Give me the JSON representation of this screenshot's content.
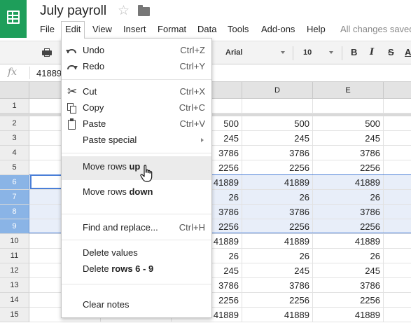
{
  "app": {
    "title": "July payroll",
    "star_icon": "star-icon",
    "folder_icon": "folder-icon",
    "save_status": "All changes saved"
  },
  "menubar": {
    "items": [
      "File",
      "Edit",
      "View",
      "Insert",
      "Format",
      "Data",
      "Tools",
      "Add-ons",
      "Help"
    ]
  },
  "toolbar": {
    "font": "Arial",
    "font_size": "10",
    "bold": "B",
    "italic": "I",
    "strike": "S",
    "text_color": "A"
  },
  "formula_bar": {
    "fx_label": "fx",
    "value": "41889"
  },
  "columns": [
    "D",
    "E"
  ],
  "rows": [
    {
      "num": "1",
      "c": "",
      "d": "",
      "e": ""
    },
    {
      "num": "2",
      "c": "500",
      "d": "500",
      "e": "500"
    },
    {
      "num": "3",
      "c": "245",
      "d": "245",
      "e": "245"
    },
    {
      "num": "4",
      "c": "3786",
      "d": "3786",
      "e": "3786"
    },
    {
      "num": "5",
      "c": "2256",
      "d": "2256",
      "e": "2256"
    },
    {
      "num": "6",
      "c": "41889",
      "d": "41889",
      "e": "41889"
    },
    {
      "num": "7",
      "c": "26",
      "d": "26",
      "e": "26"
    },
    {
      "num": "8",
      "c": "3786",
      "d": "3786",
      "e": "3786"
    },
    {
      "num": "9",
      "c": "2256",
      "d": "2256",
      "e": "2256"
    },
    {
      "num": "10",
      "c": "41889",
      "d": "41889",
      "e": "41889"
    },
    {
      "num": "11",
      "c": "26",
      "d": "26",
      "e": "26"
    },
    {
      "num": "12",
      "c": "245",
      "d": "245",
      "e": "245"
    },
    {
      "num": "13",
      "c": "3786",
      "d": "3786",
      "e": "3786"
    },
    {
      "num": "14",
      "c": "2256",
      "d": "2256",
      "e": "2256"
    },
    {
      "num": "15",
      "c": "41889",
      "d": "41889",
      "e": "41889"
    }
  ],
  "selected_rows": [
    "6",
    "7",
    "8",
    "9"
  ],
  "edit_menu": {
    "undo": {
      "label": "Undo",
      "shortcut": "Ctrl+Z"
    },
    "redo": {
      "label": "Redo",
      "shortcut": "Ctrl+Y"
    },
    "cut": {
      "label": "Cut",
      "shortcut": "Ctrl+X"
    },
    "copy": {
      "label": "Copy",
      "shortcut": "Ctrl+C"
    },
    "paste": {
      "label": "Paste",
      "shortcut": "Ctrl+V"
    },
    "paste_special": {
      "label": "Paste special"
    },
    "move_up": {
      "prefix": "Move rows ",
      "bold": "up"
    },
    "move_down": {
      "prefix": "Move rows ",
      "bold": "down"
    },
    "find_replace": {
      "label": "Find and replace...",
      "shortcut": "Ctrl+H"
    },
    "delete_values": {
      "label": "Delete values"
    },
    "delete_rows": {
      "prefix": "Delete ",
      "bold": "rows 6 - 9"
    },
    "clear_notes": {
      "label": "Clear notes"
    }
  },
  "colors": {
    "brand_green": "#1e9e5a",
    "selection_blue": "#4a7fd8",
    "selected_header": "#8ab4e6"
  }
}
